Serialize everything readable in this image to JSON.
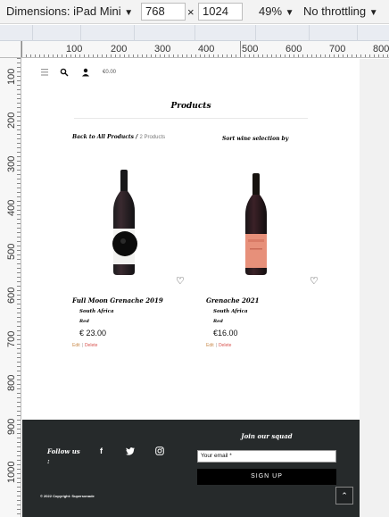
{
  "devtools": {
    "dimensions_label": "Dimensions: iPad Mini",
    "width": "768",
    "times": "×",
    "height": "1024",
    "zoom": "49%",
    "throttling": "No throttling",
    "arrow": "▼"
  },
  "rulers": {
    "top": [
      "100",
      "200",
      "300",
      "400",
      "500",
      "600",
      "700",
      "800"
    ],
    "left": [
      "100",
      "200",
      "300",
      "400",
      "500",
      "600",
      "700",
      "800",
      "900",
      "1000"
    ]
  },
  "nav": {
    "cart_total": "€0.00"
  },
  "page": {
    "title": "Products",
    "breadcrumb_link": "Back to All Products",
    "breadcrumb_sep": " / ",
    "breadcrumb_count": "2 Products",
    "sort_label": "Sort wine selection by"
  },
  "products": [
    {
      "name": "Full Moon Grenache 2019",
      "origin": "South Africa",
      "category": "Red",
      "price": "€ 23.00",
      "edit": "Edit",
      "sep": "|",
      "delete": "Delete"
    },
    {
      "name": "Grenache 2021",
      "origin": "South Africa",
      "category": "Red",
      "price": "€16.00",
      "edit": "Edit",
      "sep": "|",
      "delete": "Delete"
    }
  ],
  "footer": {
    "follow": "Follow us :",
    "social": {
      "facebook": "f",
      "twitter": "🐦",
      "instagram": "◎"
    },
    "join": "Join our squad",
    "email_placeholder": "Your email *",
    "signup": "SIGN UP",
    "copyright": "© 2022 Copyright: Supersonade",
    "totop": "⌃"
  },
  "colors": {
    "footer_bg": "#262a2b",
    "edit": "#c98a4a",
    "delete": "#d9534f"
  }
}
